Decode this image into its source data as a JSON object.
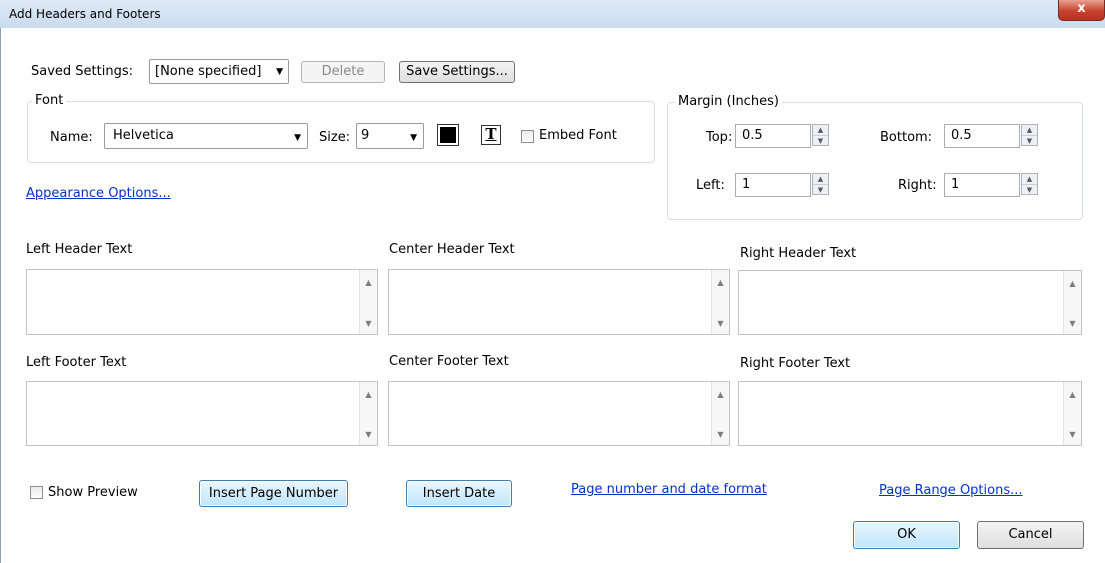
{
  "window": {
    "title": "Add Headers and Footers",
    "close_glyph": "x"
  },
  "saved_settings": {
    "label": "Saved Settings:",
    "value": "[None specified]",
    "delete_label": "Delete",
    "save_label": "Save Settings..."
  },
  "font": {
    "legend": "Font",
    "name_label": "Name:",
    "name_value": "Helvetica",
    "size_label": "Size:",
    "size_value": "9",
    "text_icon_glyph": "T",
    "embed_label": "Embed Font",
    "embed_checked": false,
    "color": "#000000"
  },
  "appearance_link": "Appearance Options...",
  "margin": {
    "legend": "Margin (Inches)",
    "top_label": "Top:",
    "top_value": "0.5",
    "bottom_label": "Bottom:",
    "bottom_value": "0.5",
    "left_label": "Left:",
    "left_value": "1",
    "right_label": "Right:",
    "right_value": "1"
  },
  "header": {
    "left_label": "Left Header Text",
    "center_label": "Center Header Text",
    "right_label": "Right Header Text"
  },
  "footer": {
    "left_label": "Left Footer Text",
    "center_label": "Center Footer Text",
    "right_label": "Right Footer Text"
  },
  "bottom": {
    "show_preview_label": "Show Preview",
    "show_preview_checked": false,
    "insert_page_number_label": "Insert Page Number",
    "insert_date_label": "Insert Date",
    "format_link": "Page number and date format",
    "range_link": "Page Range Options...",
    "ok_label": "OK",
    "cancel_label": "Cancel"
  }
}
